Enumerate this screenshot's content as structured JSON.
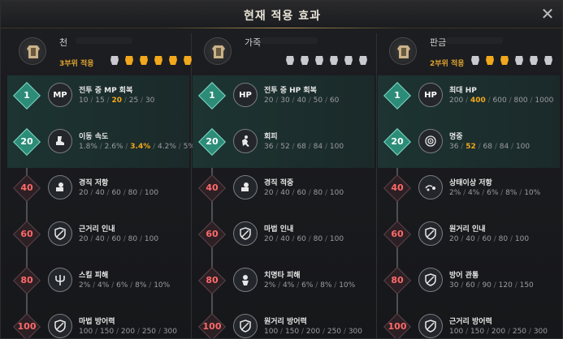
{
  "window": {
    "title": "현재 적용 효과"
  },
  "columns": [
    {
      "id": "col1",
      "name": "천",
      "set_count": "3부위 적용",
      "slots_active": [
        false,
        true,
        true,
        true,
        true,
        true
      ],
      "rows": [
        {
          "level": "1",
          "active": true,
          "icon_text": "MP",
          "icon": "mp-icon",
          "name": "전투 중 MP 회복",
          "values": [
            "10",
            "15",
            "20",
            "25",
            "30"
          ],
          "current": 2
        },
        {
          "level": "20",
          "active": true,
          "icon_text": "",
          "icon": "boot-icon",
          "name": "이동 속도",
          "values": [
            "1.8%",
            "2.6%",
            "3.4%",
            "4.2%",
            "5%"
          ],
          "current": 2
        },
        {
          "level": "40",
          "active": false,
          "icon_text": "",
          "icon": "fist-icon",
          "name": "경직 저항",
          "values": [
            "20",
            "40",
            "60",
            "80",
            "100"
          ],
          "current": -1
        },
        {
          "level": "60",
          "active": false,
          "icon_text": "",
          "icon": "shield-icon",
          "name": "근거리 인내",
          "values": [
            "20",
            "40",
            "60",
            "80",
            "100"
          ],
          "current": -1
        },
        {
          "level": "80",
          "active": false,
          "icon_text": "",
          "icon": "trident-icon",
          "name": "스킬 피해",
          "values": [
            "2%",
            "4%",
            "6%",
            "8%",
            "10%"
          ],
          "current": -1
        },
        {
          "level": "100",
          "active": false,
          "icon_text": "",
          "icon": "shield-icon",
          "name": "마법 방어력",
          "values": [
            "100",
            "150",
            "200",
            "250",
            "300"
          ],
          "current": -1
        }
      ]
    },
    {
      "id": "col2",
      "name": "가죽",
      "set_count": "",
      "slots_active": [
        false,
        false,
        false,
        false,
        false,
        false
      ],
      "rows": [
        {
          "level": "1",
          "active": true,
          "icon_text": "HP",
          "icon": "hp-icon",
          "name": "전투 중 HP 회복",
          "values": [
            "20",
            "30",
            "40",
            "50",
            "60"
          ],
          "current": -1
        },
        {
          "level": "20",
          "active": true,
          "icon_text": "",
          "icon": "dodge-icon",
          "name": "회피",
          "values": [
            "36",
            "52",
            "68",
            "84",
            "100"
          ],
          "current": -1
        },
        {
          "level": "40",
          "active": false,
          "icon_text": "",
          "icon": "fist-icon",
          "name": "경직 적중",
          "values": [
            "20",
            "40",
            "60",
            "80",
            "100"
          ],
          "current": -1
        },
        {
          "level": "60",
          "active": false,
          "icon_text": "",
          "icon": "shield-icon",
          "name": "마법 인내",
          "values": [
            "20",
            "40",
            "60",
            "80",
            "100"
          ],
          "current": -1
        },
        {
          "level": "80",
          "active": false,
          "icon_text": "",
          "icon": "crit-icon",
          "name": "치명타 피해",
          "values": [
            "2%",
            "4%",
            "6%",
            "8%",
            "10%"
          ],
          "current": -1
        },
        {
          "level": "100",
          "active": false,
          "icon_text": "",
          "icon": "shield-icon",
          "name": "원거리 방어력",
          "values": [
            "100",
            "150",
            "200",
            "250",
            "300"
          ],
          "current": -1
        }
      ]
    },
    {
      "id": "col3",
      "name": "판금",
      "set_count": "2부위 적용",
      "slots_active": [
        false,
        true,
        true,
        false,
        false,
        false
      ],
      "rows": [
        {
          "level": "1",
          "active": true,
          "icon_text": "HP",
          "icon": "hp-icon",
          "name": "최대 HP",
          "values": [
            "200",
            "400",
            "600",
            "800",
            "1000"
          ],
          "current": 1
        },
        {
          "level": "20",
          "active": true,
          "icon_text": "",
          "icon": "target-icon",
          "name": "명중",
          "values": [
            "36",
            "52",
            "68",
            "84",
            "100"
          ],
          "current": 1
        },
        {
          "level": "40",
          "active": false,
          "icon_text": "",
          "icon": "status-icon",
          "name": "상태이상 저항",
          "values": [
            "2%",
            "4%",
            "6%",
            "8%",
            "10%"
          ],
          "current": -1
        },
        {
          "level": "60",
          "active": false,
          "icon_text": "",
          "icon": "shield-icon",
          "name": "원거리 인내",
          "values": [
            "20",
            "40",
            "60",
            "80",
            "100"
          ],
          "current": -1
        },
        {
          "level": "80",
          "active": false,
          "icon_text": "",
          "icon": "shield-icon",
          "name": "방어 관통",
          "values": [
            "30",
            "60",
            "90",
            "120",
            "150"
          ],
          "current": -1
        },
        {
          "level": "100",
          "active": false,
          "icon_text": "",
          "icon": "shield-icon",
          "name": "근거리 방어력",
          "values": [
            "100",
            "150",
            "200",
            "250",
            "300"
          ],
          "current": -1
        }
      ]
    }
  ]
}
